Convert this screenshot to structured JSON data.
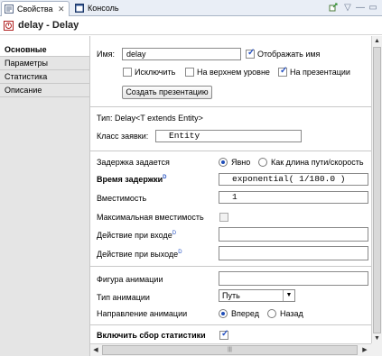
{
  "tabs": [
    {
      "label": "Свойства",
      "close": "✕"
    },
    {
      "label": "Консоль"
    }
  ],
  "toolbar_icons": [
    "pin-icon",
    "chevron-down-icon",
    "minimize-icon",
    "maximize-icon"
  ],
  "header": {
    "title": "delay - Delay"
  },
  "sidebar": {
    "items": [
      {
        "label": "Основные"
      },
      {
        "label": "Параметры"
      },
      {
        "label": "Статистика"
      },
      {
        "label": "Описание"
      }
    ]
  },
  "form": {
    "name_label": "Имя:",
    "name_value": "delay",
    "show_name_label": "Отображать имя",
    "show_name_checked": true,
    "exclude_label": "Исключить",
    "exclude_checked": false,
    "top_level_label": "На верхнем уровне",
    "top_level_checked": false,
    "presentation_label": "На презентации",
    "presentation_checked": true,
    "create_presentation_button": "Создать презентацию",
    "type_text": "Тип: Delay<T extends Entity>",
    "request_class_label": "Класс заявки:",
    "request_class_value": "Entity",
    "delay_defined_label": "Задержка задается",
    "delay_option_explicit": "Явно",
    "delay_option_path": "Как длина пути/скорость",
    "delay_time_label": "Время задержки",
    "delay_time_value": "exponential( 1/180.0 )",
    "capacity_label": "Вместимость",
    "capacity_value": "1",
    "max_capacity_label": "Максимальная вместимость",
    "max_capacity_checked": false,
    "on_enter_label": "Действие при входе",
    "on_enter_value": "",
    "on_exit_label": "Действие при выходе",
    "on_exit_value": "",
    "animation_shape_label": "Фигура анимации",
    "animation_shape_value": "",
    "animation_type_label": "Тип анимации",
    "animation_type_value": "Путь",
    "animation_direction_label": "Направление анимации",
    "direction_forward": "Вперед",
    "direction_back": "Назад",
    "enable_stats_label": "Включить сбор статистики",
    "enable_stats_checked": true,
    "code_marker": "D"
  },
  "colors": {
    "accent": "#2a55c4",
    "tab_bg": "#e9eef6",
    "sidebar_bg": "#e5e5e5"
  }
}
